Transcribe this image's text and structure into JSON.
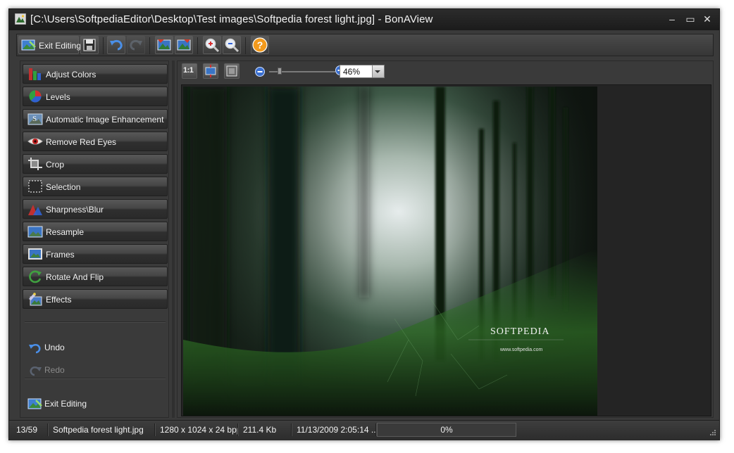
{
  "window": {
    "title": "[C:\\Users\\SoftpediaEditor\\Desktop\\Test images\\Softpedia forest light.jpg] - BonAView",
    "controls": {
      "minimize": "–",
      "maximize": "▭",
      "close": "✕"
    }
  },
  "toolbar": {
    "exit_editing_label": "Exit Editing",
    "icons": [
      "save-icon",
      "undo-icon",
      "redo-icon",
      "image-prev-icon",
      "image-next-icon",
      "zoom-in-icon",
      "zoom-out-icon",
      "help-icon"
    ]
  },
  "tools": [
    {
      "name": "adjust-colors",
      "label": "Adjust Colors"
    },
    {
      "name": "levels",
      "label": "Levels"
    },
    {
      "name": "automatic-image-enhancement",
      "label": "Automatic Image Enhancement"
    },
    {
      "name": "remove-red-eyes",
      "label": "Remove Red Eyes"
    },
    {
      "name": "crop",
      "label": "Crop"
    },
    {
      "name": "selection",
      "label": "Selection"
    },
    {
      "name": "sharpness-blur",
      "label": "Sharpness\\Blur"
    },
    {
      "name": "resample",
      "label": "Resample"
    },
    {
      "name": "frames",
      "label": "Frames"
    },
    {
      "name": "rotate-and-flip",
      "label": "Rotate And Flip"
    },
    {
      "name": "effects",
      "label": "Effects"
    }
  ],
  "history": {
    "undo_label": "Undo",
    "redo_label": "Redo",
    "exit_editing_label": "Exit Editing"
  },
  "view": {
    "actual_size_label": "1:1",
    "zoom_value": "46%",
    "zoom_slider_level": 0.14
  },
  "photo": {
    "watermark_brand": "SOFTPEDIA",
    "watermark_url": "www.softpedia.com"
  },
  "status": {
    "index": "13/59",
    "filename": "Softpedia forest light.jpg",
    "dimensions": "1280 x 1024 x 24 bpp",
    "size": "211.4 Kb",
    "date": "11/13/2009 2:05:14 ...",
    "progress_text": "0%",
    "progress_value": 0
  },
  "colors": {
    "accent_blue": "#3b7bd6",
    "help_orange": "#f39a1c",
    "window_bg": "#3a3a3a"
  }
}
